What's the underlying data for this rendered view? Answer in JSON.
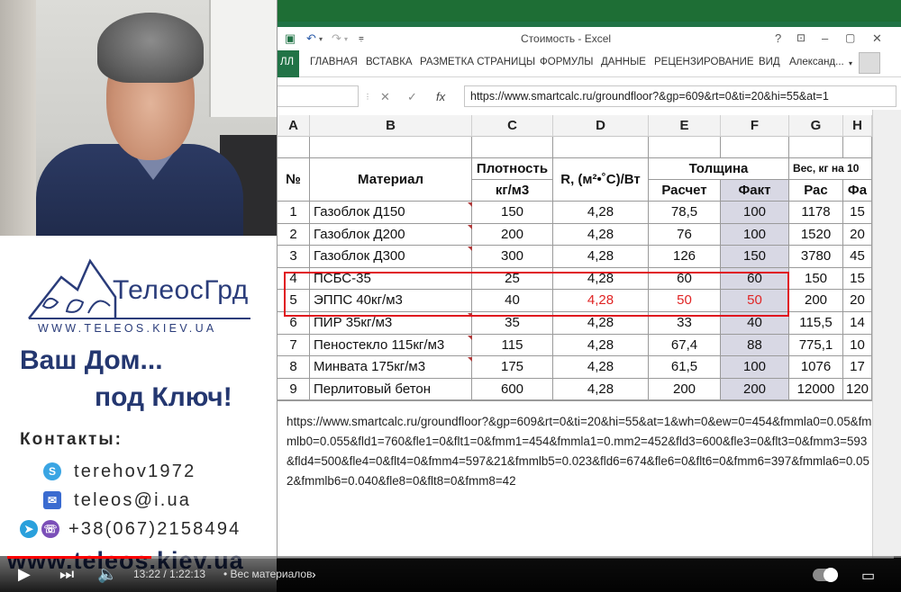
{
  "presenter": {
    "logo_text": "ТелеосГрд",
    "site_small": "WWW.TELEOS.KIEV.UA",
    "slogan_line1": "Ваш Дом...",
    "slogan_line2": "под Ключ!",
    "contacts_title": "Контакты:",
    "skype": "terehov1972",
    "email": "teleos@i.ua",
    "phone": "+38(067)2158494",
    "site_big": "www.teleos.kiev.ua"
  },
  "excel": {
    "title": "Стоимость - Excel",
    "file_tab": "ЛЛ",
    "tabs": [
      "ГЛАВНАЯ",
      "ВСТАВКА",
      "РАЗМЕТКА СТРАНИЦЫ",
      "ФОРМУЛЫ",
      "ДАННЫЕ",
      "РЕЦЕНЗИРОВАНИЕ",
      "ВИД"
    ],
    "user": "Александ...",
    "formula": "https://www.smartcalc.ru/groundfloor?&gp=609&rt=0&ti=20&hi=55&at=1",
    "columns": [
      "A",
      "B",
      "C",
      "D",
      "E",
      "F",
      "G",
      "H"
    ],
    "headers": {
      "num": "№",
      "material": "Материал",
      "density": "Плотность",
      "density_unit": "кг/м3",
      "r": "R, (м²•˚С)/Вт",
      "thickness": "Толщина",
      "calc": "Расчет",
      "fact": "Факт",
      "weight": "Вес, кг на 10",
      "weight_calc": "Рас",
      "weight_fact": "Фа"
    },
    "rows": [
      {
        "n": "1",
        "material": "Газоблок Д150",
        "density": "150",
        "r": "4,28",
        "calc": "78,5",
        "fact": "100",
        "w1": "1178",
        "w2": "15"
      },
      {
        "n": "2",
        "material": "Газоблок Д200",
        "density": "200",
        "r": "4,28",
        "calc": "76",
        "fact": "100",
        "w1": "1520",
        "w2": "20"
      },
      {
        "n": "3",
        "material": "Газоблок Д300",
        "density": "300",
        "r": "4,28",
        "calc": "126",
        "fact": "150",
        "w1": "3780",
        "w2": "45"
      },
      {
        "n": "4",
        "material": "ПСБС-35",
        "density": "25",
        "r": "4,28",
        "calc": "60",
        "fact": "60",
        "w1": "150",
        "w2": "15"
      },
      {
        "n": "5",
        "material": "ЭППС 40кг/м3",
        "density": "40",
        "r": "4,28",
        "calc": "50",
        "fact": "50",
        "w1": "200",
        "w2": "20"
      },
      {
        "n": "6",
        "material": "ПИР 35кг/м3",
        "density": "35",
        "r": "4,28",
        "calc": "33",
        "fact": "40",
        "w1": "115,5",
        "w2": "14"
      },
      {
        "n": "7",
        "material": "Пеностекло 115кг/м3",
        "density": "115",
        "r": "4,28",
        "calc": "67,4",
        "fact": "88",
        "w1": "775,1",
        "w2": "10"
      },
      {
        "n": "8",
        "material": "Минвата 175кг/м3",
        "density": "175",
        "r": "4,28",
        "calc": "61,5",
        "fact": "100",
        "w1": "1076",
        "w2": "17"
      },
      {
        "n": "9",
        "material": "Перлитовый бетон",
        "density": "600",
        "r": "4,28",
        "calc": "200",
        "fact": "200",
        "w1": "12000",
        "w2": "120"
      }
    ],
    "url_note": "https://www.smartcalc.ru/groundfloor?&gp=609&rt=0&ti=20&hi=55&at=1&wh=0&ew=0=454&fmmla0=0.05&fmmlb0=0.055&fld1=760&fle1=0&flt1=0&fmm1=454&fmmla1=0.mm2=452&fld3=600&fle3=0&flt3=0&fmm3=593&fld4=500&fle4=0&flt4=0&fmm4=597&21&fmmlb5=0.023&fld6=674&fle6=0&flt6=0&fmm6=397&fmmla6=0.052&fmmlb6=0.040&fle8=0&flt8=0&fmm8=42"
  },
  "player": {
    "time": "13:22 / 1:22:13",
    "chapter": "• Вес материалов",
    "progress_fraction": 0.163,
    "accent": "#ff0000"
  }
}
